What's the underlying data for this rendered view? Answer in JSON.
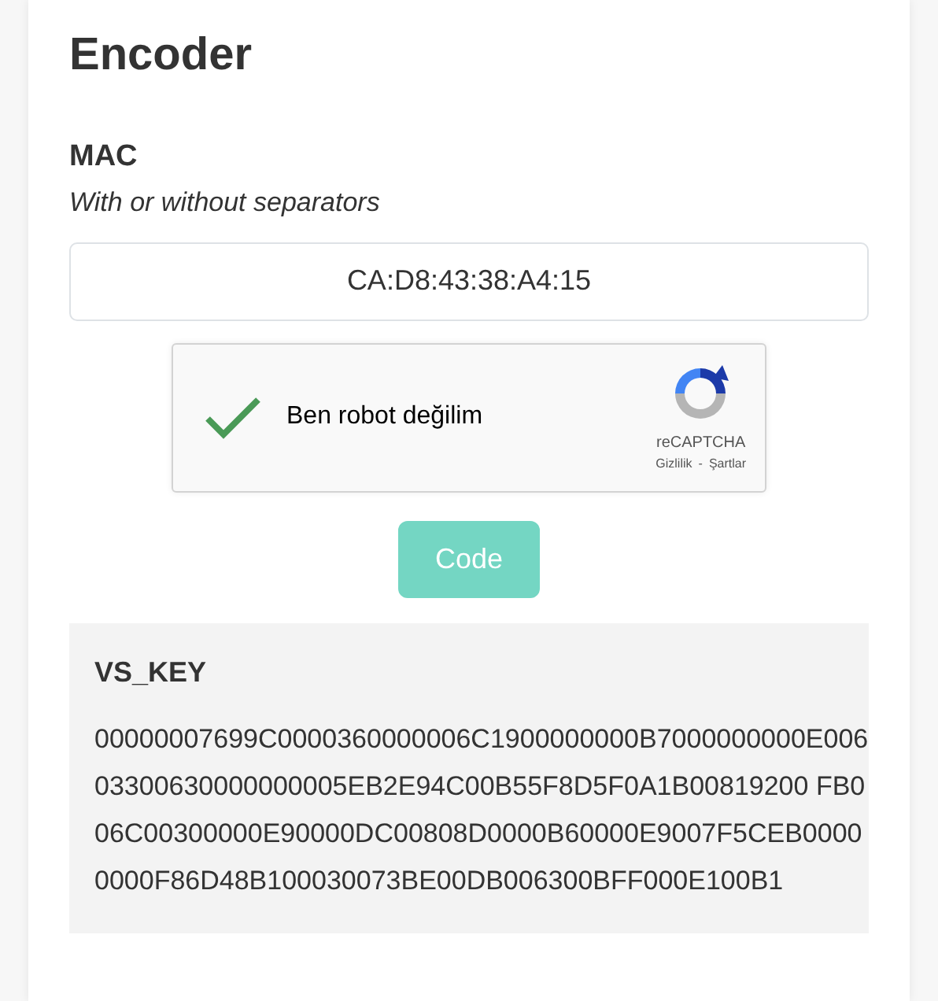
{
  "title": "Encoder",
  "mac": {
    "label": "MAC",
    "hint": "With or without separators",
    "value": "CA:D8:43:38:A4:15"
  },
  "captcha": {
    "label": "Ben robot değilim",
    "checked": true,
    "brand": "reCAPTCHA",
    "privacy": "Gizlilik",
    "separator": "-",
    "terms": "Şartlar"
  },
  "button": {
    "label": "Code",
    "disabled": true
  },
  "result": {
    "label": "VS_KEY",
    "value": "00000007699C0000360000006C1900000000B7000000000E00603300630000000005EB2E94C00B55F8D5F0A1B00819200 FB006C00300000E90000DC00808D0000B60000E9007F5CEB00000000F86D48B100030073BE00DB006300BFF000E100B1"
  }
}
